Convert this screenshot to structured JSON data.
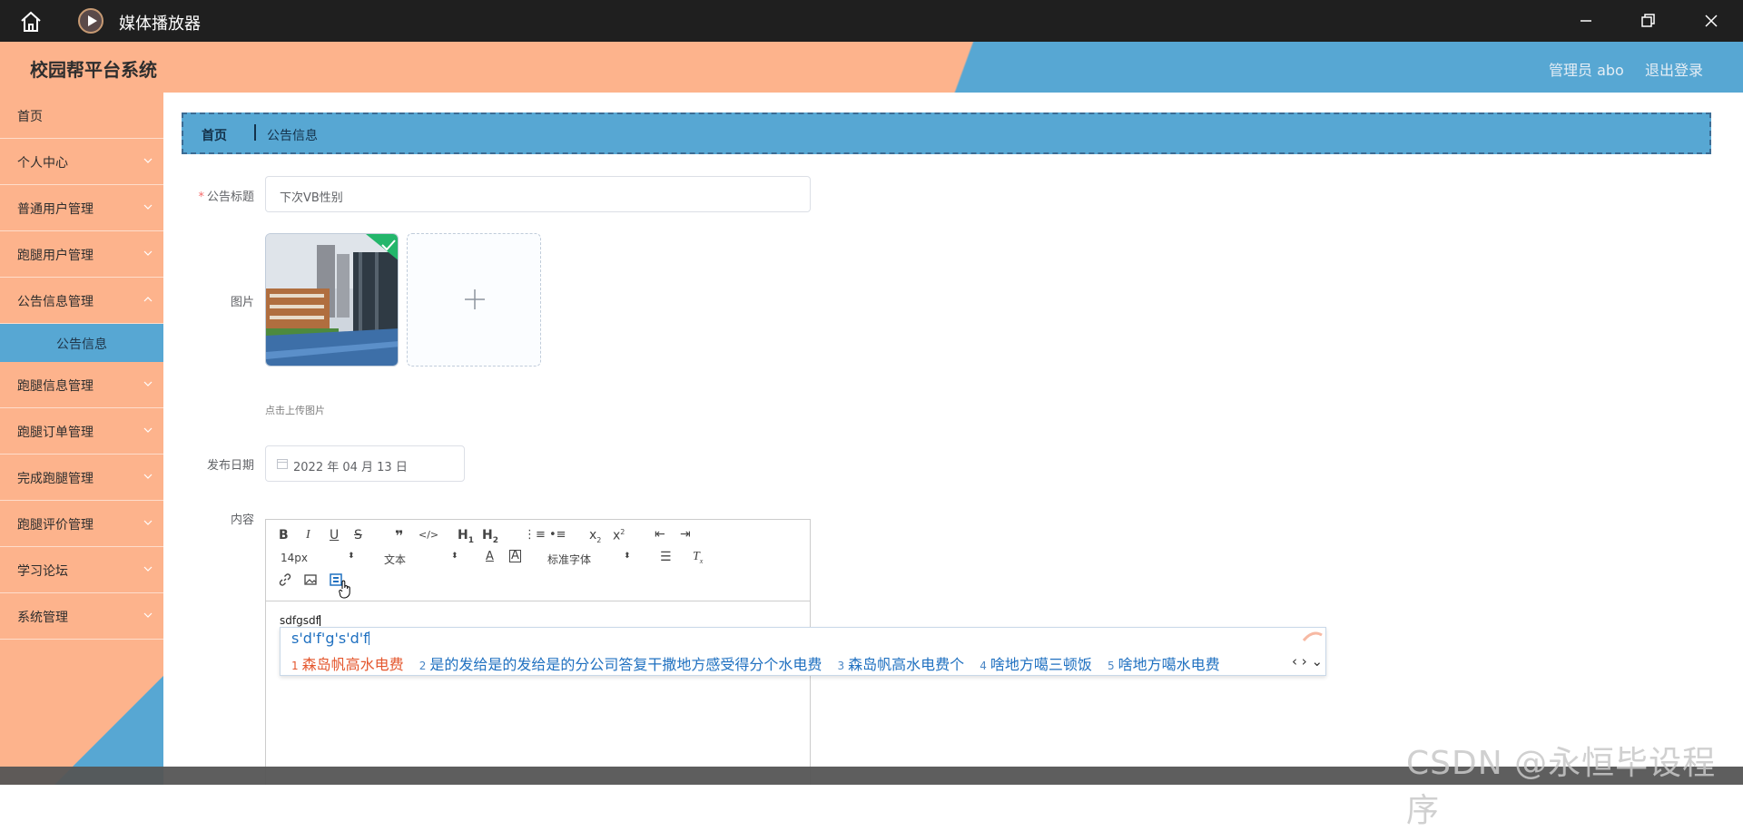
{
  "window": {
    "title": "媒体播放器",
    "home_icon": "home-icon",
    "app_icon": "play-circle-icon",
    "controls": [
      "minimize-icon",
      "restore-icon",
      "close-icon"
    ]
  },
  "header": {
    "brand": "校园帮平台系统",
    "admin": "管理员 abo",
    "logout": "退出登录",
    "colors": {
      "left": "#fdb38c",
      "right": "#57a7d3"
    }
  },
  "sidebar": {
    "items": [
      {
        "label": "首页",
        "chevron": false
      },
      {
        "label": "个人中心",
        "chevron": true
      },
      {
        "label": "普通用户管理",
        "chevron": true
      },
      {
        "label": "跑腿用户管理",
        "chevron": true
      },
      {
        "label": "公告信息管理",
        "chevron": true,
        "expanded": true
      },
      {
        "label": "跑腿信息管理",
        "chevron": true
      },
      {
        "label": "跑腿订单管理",
        "chevron": true
      },
      {
        "label": "完成跑腿管理",
        "chevron": true
      },
      {
        "label": "跑腿评价管理",
        "chevron": true
      },
      {
        "label": "学习论坛",
        "chevron": true
      },
      {
        "label": "系统管理",
        "chevron": true
      }
    ],
    "active_sub": "公告信息"
  },
  "breadcrumb": {
    "home": "首页",
    "current": "公告信息"
  },
  "form": {
    "title_label": "公告标题",
    "title_value": "下次VB性别",
    "image_label": "图片",
    "upload_hint": "点击上传图片",
    "date_label": "发布日期",
    "date_value": "2022 年 04 月 13 日",
    "content_label": "内容"
  },
  "editor": {
    "font_size": "14px",
    "block_type": "文本",
    "font_family": "标准字体",
    "content": "sdfgsdf"
  },
  "ime": {
    "composition": "s'd'f'g's'd'f",
    "candidates": [
      {
        "n": "1",
        "text": "森岛帆高水电费"
      },
      {
        "n": "2",
        "text": "是的发给是的发给是的分公司答复干撒地方感受得分个水电费"
      },
      {
        "n": "3",
        "text": "森岛帆高水电费个"
      },
      {
        "n": "4",
        "text": "啥地方噶三顿饭"
      },
      {
        "n": "5",
        "text": "啥地方噶水电费"
      }
    ],
    "nav": "‹ › ⌄"
  },
  "watermark": "CSDN @永恒毕设程序"
}
